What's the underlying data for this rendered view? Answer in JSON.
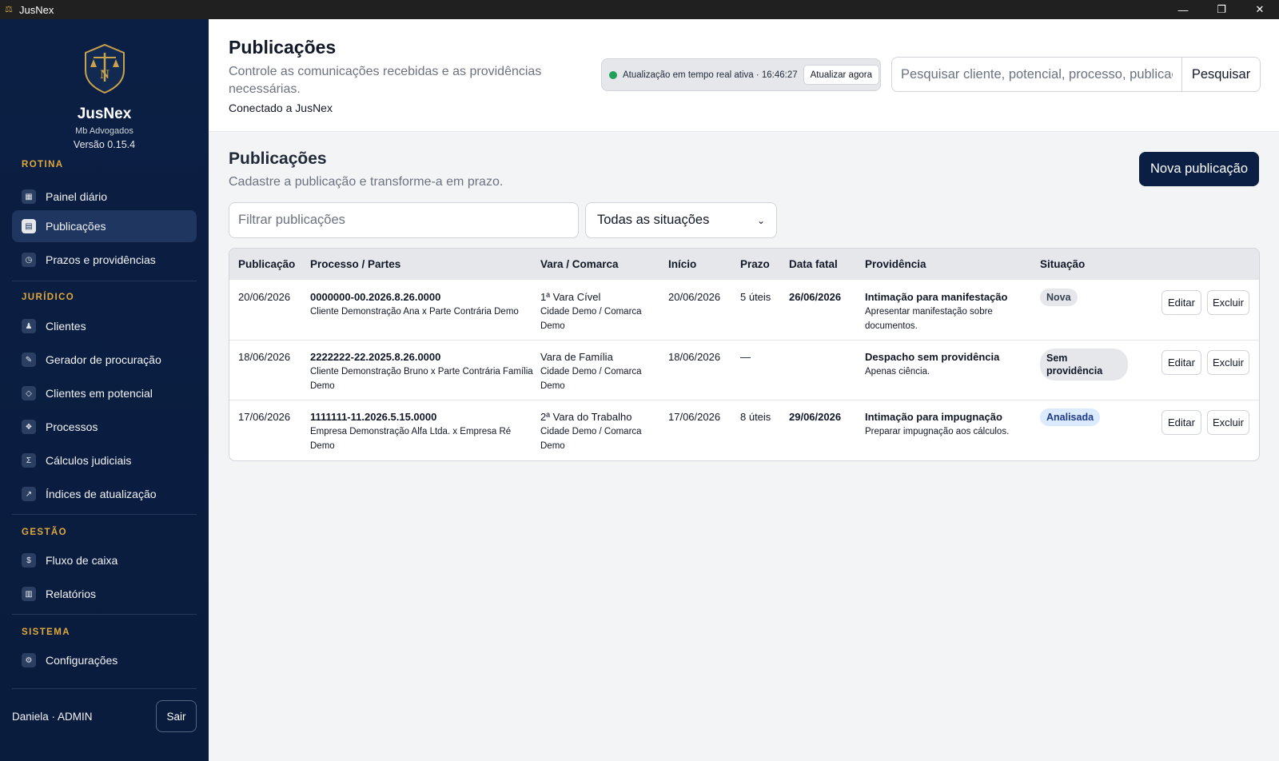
{
  "window": {
    "title": "JusNex"
  },
  "sidebar": {
    "brand_name": "JusNex",
    "org": "Mb Advogados",
    "version": "Versão 0.15.4",
    "sections": {
      "rotina": "ROTINA",
      "juridico": "JURÍDICO",
      "gestao": "GESTÃO",
      "sistema": "SISTEMA"
    },
    "items": [
      {
        "label": "Painel diário",
        "icon": "dashboard-icon"
      },
      {
        "label": "Publicações",
        "icon": "publications-icon",
        "active": true
      },
      {
        "label": "Prazos e providências",
        "icon": "clock-icon"
      },
      {
        "label": "Clientes",
        "icon": "user-icon"
      },
      {
        "label": "Gerador de procuração",
        "icon": "pen-icon"
      },
      {
        "label": "Clientes em potencial",
        "icon": "target-icon"
      },
      {
        "label": "Processos",
        "icon": "folder-icon"
      },
      {
        "label": "Cálculos judiciais",
        "icon": "sigma-icon"
      },
      {
        "label": "Índices de atualização",
        "icon": "trend-icon"
      },
      {
        "label": "Fluxo de caixa",
        "icon": "dollar-icon"
      },
      {
        "label": "Relatórios",
        "icon": "report-icon"
      },
      {
        "label": "Configurações",
        "icon": "gear-icon"
      }
    ],
    "user": "Daniela · ADMIN",
    "logout": "Sair"
  },
  "header": {
    "title": "Publicações",
    "subtitle": "Controle as comunicações recebidas e as providências necessárias.",
    "connection": "Conectado a JusNex",
    "realtime_text": "Atualização em tempo real ativa · 16:46:27",
    "refresh_button": "Atualizar agora",
    "search_placeholder": "Pesquisar cliente, potencial, processo, publicação",
    "search_button": "Pesquisar"
  },
  "section": {
    "title": "Publicações",
    "subtitle": "Cadastre a publicação e transforme-a em prazo.",
    "new_button": "Nova publicação",
    "filter_placeholder": "Filtrar publicações",
    "status_filter": "Todas as situações"
  },
  "table": {
    "headers": [
      "Publicação",
      "Processo / Partes",
      "Vara / Comarca",
      "Início",
      "Prazo",
      "Data fatal",
      "Providência",
      "Situação"
    ],
    "rows": [
      {
        "publicacao": "20/06/2026",
        "processo": "0000000-00.2026.8.26.0000",
        "partes": "Cliente Demonstração Ana x Parte Contrária Demo",
        "vara": "1ª Vara Cível",
        "comarca": "Cidade Demo / Comarca Demo",
        "inicio": "20/06/2026",
        "prazo": "5 úteis",
        "data_fatal": "26/06/2026",
        "providencia": "Intimação para manifestação",
        "providencia_desc": "Apresentar manifestação sobre documentos.",
        "situacao": "Nova",
        "edit": "Editar",
        "delete": "Excluir"
      },
      {
        "publicacao": "18/06/2026",
        "processo": "2222222-22.2025.8.26.0000",
        "partes": "Cliente Demonstração Bruno x Parte Contrária Família Demo",
        "vara": "Vara de Família",
        "comarca": "Cidade Demo / Comarca Demo",
        "inicio": "18/06/2026",
        "prazo": "—",
        "data_fatal": "",
        "providencia": "Despacho sem providência",
        "providencia_desc": "Apenas ciência.",
        "situacao": "Sem providência",
        "edit": "Editar",
        "delete": "Excluir"
      },
      {
        "publicacao": "17/06/2026",
        "processo": "1111111-11.2026.5.15.0000",
        "partes": "Empresa Demonstração Alfa Ltda. x Empresa Ré Demo",
        "vara": "2ª Vara do Trabalho",
        "comarca": "Cidade Demo / Comarca Demo",
        "inicio": "17/06/2026",
        "prazo": "8 úteis",
        "data_fatal": "29/06/2026",
        "providencia": "Intimação para impugnação",
        "providencia_desc": "Preparar impugnação aos cálculos.",
        "situacao": "Analisada",
        "edit": "Editar",
        "delete": "Excluir"
      }
    ]
  },
  "colors": {
    "sidebar_bg": "#0b1f44",
    "accent_gold": "#e0a93b",
    "primary_button": "#0b1f44",
    "status_online": "#22a05a"
  }
}
